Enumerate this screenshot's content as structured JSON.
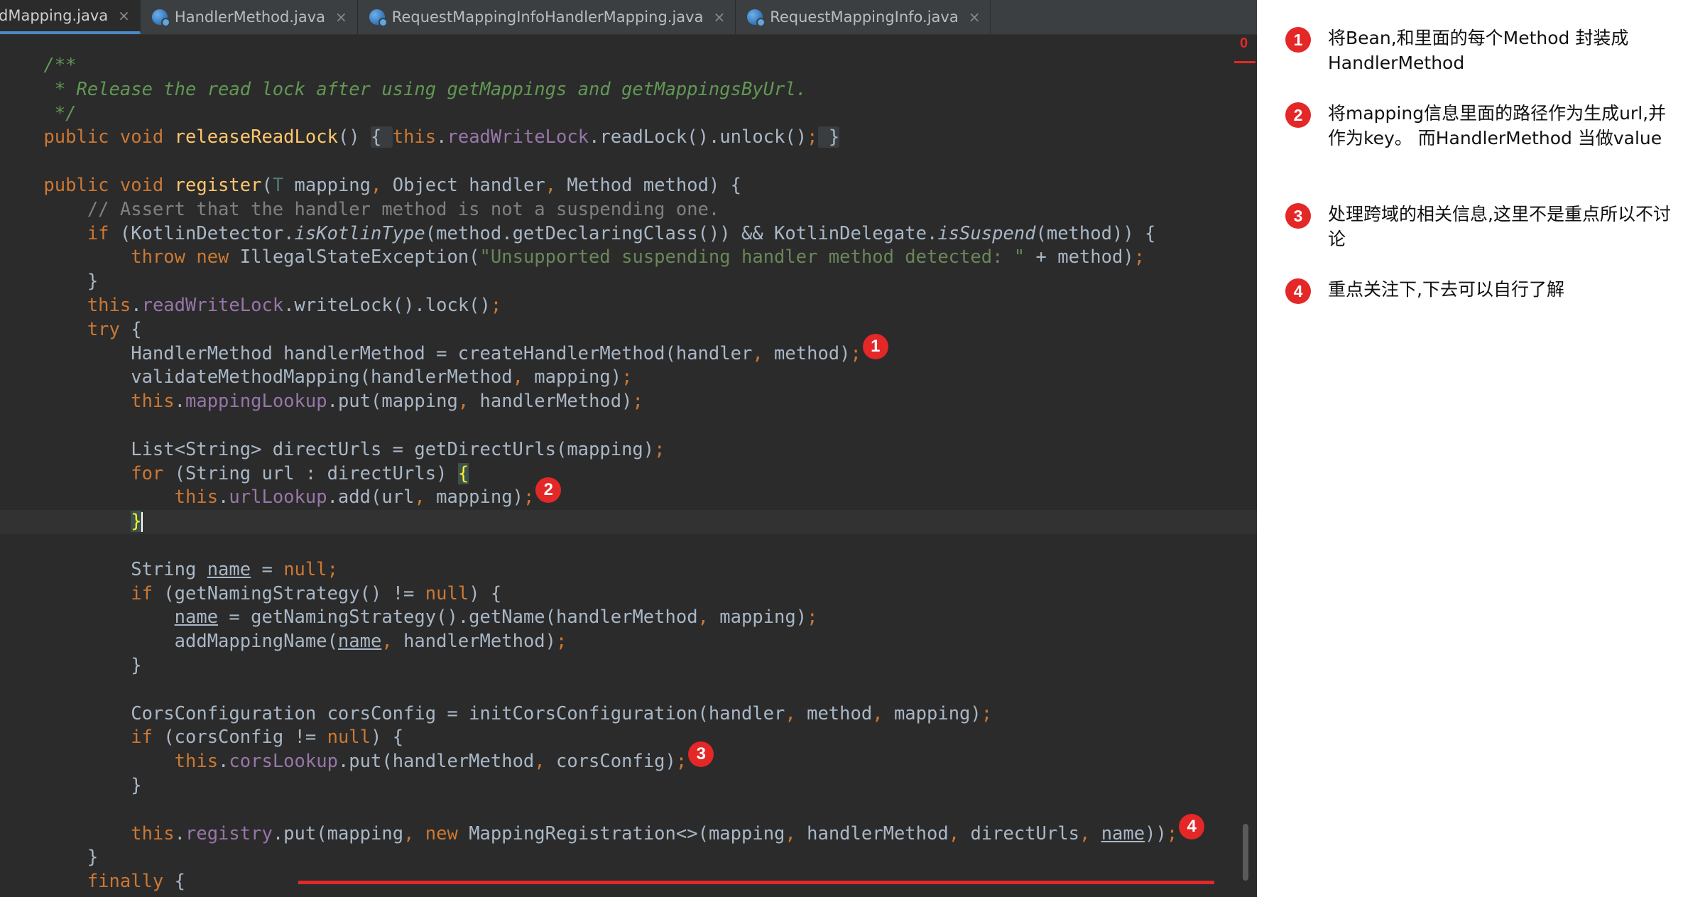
{
  "tabs": [
    {
      "label": "dMapping.java",
      "active": true
    },
    {
      "label": "HandlerMethod.java",
      "active": false
    },
    {
      "label": "RequestMappingInfoHandlerMapping.java",
      "active": false
    },
    {
      "label": "RequestMappingInfo.java",
      "active": false
    }
  ],
  "tab_close_glyph": "×",
  "gutter_warning": "0",
  "code_lines": [
    [
      [
        "doc",
        "    /**"
      ]
    ],
    [
      [
        "doc",
        "     * Release the read lock after using getMappings and getMappingsByUrl."
      ]
    ],
    [
      [
        "doc",
        "     */"
      ]
    ],
    [
      [
        "kw",
        "    public void "
      ],
      [
        "fn",
        "releaseReadLock"
      ],
      [
        "",
        "() "
      ],
      [
        "fold",
        "{ "
      ],
      [
        "kw",
        "this"
      ],
      [
        "",
        "."
      ],
      [
        "fld",
        "readWriteLock"
      ],
      [
        "",
        ".readLock().unlock()"
      ],
      [
        "kw",
        ";"
      ],
      [
        "fold",
        " }"
      ]
    ],
    [],
    [
      [
        "kw",
        "    public void "
      ],
      [
        "fn",
        "register"
      ],
      [
        "",
        "("
      ],
      [
        "tp",
        "T"
      ],
      [
        "",
        " mapping"
      ],
      [
        "kw",
        ", "
      ],
      [
        "",
        "Object handler"
      ],
      [
        "kw",
        ", "
      ],
      [
        "",
        "Method method) {"
      ]
    ],
    [
      [
        "cm",
        "        // Assert that the handler method is not a suspending one."
      ]
    ],
    [
      [
        "kw",
        "        if "
      ],
      [
        "",
        "(KotlinDetector."
      ],
      [
        "it",
        "isKotlinType"
      ],
      [
        "",
        "(method.getDeclaringClass()) && KotlinDelegate."
      ],
      [
        "it",
        "isSuspend"
      ],
      [
        "",
        "(method)) {"
      ]
    ],
    [
      [
        "kw",
        "            throw new "
      ],
      [
        "",
        "IllegalStateException("
      ],
      [
        "str",
        "\"Unsupported suspending handler method detected: \""
      ],
      [
        "",
        " + method)"
      ],
      [
        "kw",
        ";"
      ]
    ],
    [
      [
        "",
        "        }"
      ]
    ],
    [
      [
        "kw",
        "        this"
      ],
      [
        "",
        "."
      ],
      [
        "fld",
        "readWriteLock"
      ],
      [
        "",
        ".writeLock().lock()"
      ],
      [
        "kw",
        ";"
      ]
    ],
    [
      [
        "kw",
        "        try "
      ],
      [
        "",
        "{"
      ]
    ],
    [
      [
        "",
        "            HandlerMethod handlerMethod = createHandlerMethod(handler"
      ],
      [
        "kw",
        ", "
      ],
      [
        "",
        "method)"
      ],
      [
        "kw",
        ";"
      ]
    ],
    [
      [
        "",
        "            validateMethodMapping(handlerMethod"
      ],
      [
        "kw",
        ", "
      ],
      [
        "",
        "mapping)"
      ],
      [
        "kw",
        ";"
      ]
    ],
    [
      [
        "kw",
        "            this"
      ],
      [
        "",
        "."
      ],
      [
        "fld",
        "mappingLookup"
      ],
      [
        "",
        ".put(mapping"
      ],
      [
        "kw",
        ", "
      ],
      [
        "",
        "handlerMethod)"
      ],
      [
        "kw",
        ";"
      ]
    ],
    [],
    [
      [
        "",
        "            List<String> directUrls = getDirectUrls(mapping)"
      ],
      [
        "kw",
        ";"
      ]
    ],
    [
      [
        "kw",
        "            for "
      ],
      [
        "",
        "(String url : directUrls) "
      ],
      [
        "brace-hl",
        "{"
      ]
    ],
    [
      [
        "kw",
        "                this"
      ],
      [
        "",
        "."
      ],
      [
        "fld",
        "urlLookup"
      ],
      [
        "",
        ".add(url"
      ],
      [
        "kw",
        ", "
      ],
      [
        "",
        "mapping)"
      ],
      [
        "kw",
        ";"
      ]
    ],
    [
      [
        "",
        "            "
      ],
      [
        "brace-hl",
        "}"
      ],
      [
        "caret",
        ""
      ]
    ],
    [],
    [
      [
        "",
        "            String "
      ],
      [
        "ul",
        "name"
      ],
      [
        "",
        " = "
      ],
      [
        "kw",
        "null;"
      ]
    ],
    [
      [
        "kw",
        "            if "
      ],
      [
        "",
        "(getNamingStrategy() != "
      ],
      [
        "kw",
        "null"
      ],
      [
        "",
        ") {"
      ]
    ],
    [
      [
        "",
        "                "
      ],
      [
        "ul",
        "name"
      ],
      [
        "",
        " = getNamingStrategy().getName(handlerMethod"
      ],
      [
        "kw",
        ", "
      ],
      [
        "",
        "mapping)"
      ],
      [
        "kw",
        ";"
      ]
    ],
    [
      [
        "",
        "                addMappingName("
      ],
      [
        "ul",
        "name"
      ],
      [
        "kw",
        ", "
      ],
      [
        "",
        "handlerMethod)"
      ],
      [
        "kw",
        ";"
      ]
    ],
    [
      [
        "",
        "            }"
      ]
    ],
    [],
    [
      [
        "",
        "            CorsConfiguration corsConfig = initCorsConfiguration(handler"
      ],
      [
        "kw",
        ", "
      ],
      [
        "",
        "method"
      ],
      [
        "kw",
        ", "
      ],
      [
        "",
        "mapping)"
      ],
      [
        "kw",
        ";"
      ]
    ],
    [
      [
        "kw",
        "            if "
      ],
      [
        "",
        "(corsConfig != "
      ],
      [
        "kw",
        "null"
      ],
      [
        "",
        ") {"
      ]
    ],
    [
      [
        "kw",
        "                this"
      ],
      [
        "",
        "."
      ],
      [
        "fld",
        "corsLookup"
      ],
      [
        "",
        ".put(handlerMethod"
      ],
      [
        "kw",
        ", "
      ],
      [
        "",
        "corsConfig)"
      ],
      [
        "kw",
        ";"
      ]
    ],
    [
      [
        "",
        "            }"
      ]
    ],
    [],
    [
      [
        "kw",
        "            this"
      ],
      [
        "",
        "."
      ],
      [
        "fld",
        "registry"
      ],
      [
        "",
        ".put(mapping"
      ],
      [
        "kw",
        ", new "
      ],
      [
        "",
        "MappingRegistration<>(mapping"
      ],
      [
        "kw",
        ", "
      ],
      [
        "",
        "handlerMethod"
      ],
      [
        "kw",
        ", "
      ],
      [
        "",
        "directUrls"
      ],
      [
        "kw",
        ", "
      ],
      [
        "ul",
        "name"
      ],
      [
        "",
        "))"
      ],
      [
        "kw",
        ";"
      ]
    ],
    [
      [
        "",
        "        }"
      ]
    ],
    [
      [
        "kw",
        "        finally "
      ],
      [
        "",
        "{"
      ]
    ]
  ],
  "current_line_index": 19,
  "code_markers": [
    {
      "num": "1",
      "line": 12
    },
    {
      "num": "2",
      "line": 18
    },
    {
      "num": "3",
      "line": 29
    },
    {
      "num": "4",
      "line": 32
    }
  ],
  "notes": [
    {
      "num": "1",
      "text": "将Bean,和里面的每个Method 封装成HandlerMethod"
    },
    {
      "num": "2",
      "text": "将mapping信息里面的路径作为生成url,并作为key。 而HandlerMethod 当做value"
    },
    {
      "num": "3",
      "text": "处理跨域的相关信息,这里不是重点所以不讨论"
    },
    {
      "num": "4",
      "text": "重点关注下,下去可以自行了解"
    }
  ]
}
